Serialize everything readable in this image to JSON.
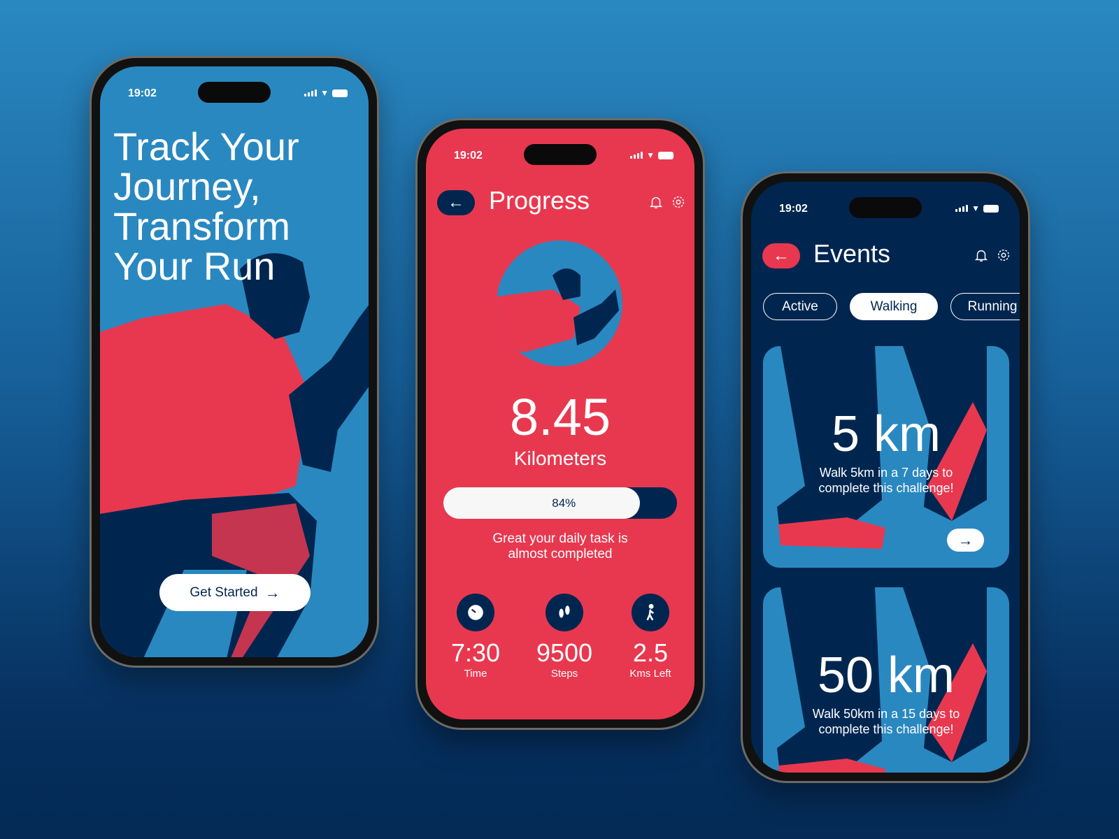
{
  "colors": {
    "red": "#E8384F",
    "navy": "#002650",
    "blue": "#2A88C0"
  },
  "status": {
    "time": "19:02"
  },
  "screen1": {
    "headline_lines": [
      "Track Your",
      "Journey,",
      "Transform",
      "Your Run"
    ],
    "cta_label": "Get Started",
    "cta_icon": "arrow-right-icon"
  },
  "screen2": {
    "title": "Progress",
    "distance": "8.45",
    "distance_unit": "Kilometers",
    "progress_percent": 84,
    "progress_label": "84%",
    "message_lines": [
      "Great your daily task is",
      "almost completed"
    ],
    "stats": [
      {
        "icon": "clock-icon",
        "value": "7:30",
        "label": "Time"
      },
      {
        "icon": "footsteps-icon",
        "value": "9500",
        "label": "Steps"
      },
      {
        "icon": "walking-person-icon",
        "value": "2.5",
        "label": "Kms Left"
      }
    ]
  },
  "screen3": {
    "title": "Events",
    "chips": [
      {
        "label": "Active",
        "selected": false
      },
      {
        "label": "Walking",
        "selected": true
      },
      {
        "label": "Running",
        "selected": false
      }
    ],
    "events": [
      {
        "distance": "5 km",
        "desc_lines": [
          "Walk 5km in a 7 days to",
          "complete this challenge!"
        ]
      },
      {
        "distance": "50 km",
        "desc_lines": [
          "Walk 50km in a 15 days to",
          "complete this challenge!"
        ]
      }
    ]
  }
}
